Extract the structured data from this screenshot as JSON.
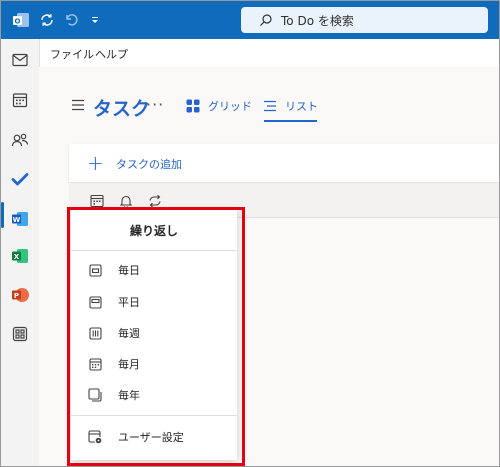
{
  "search": {
    "placeholder": "To Do を検索"
  },
  "menubar": {
    "file": "ファイル",
    "help": "ヘルプ"
  },
  "header": {
    "title": "タスク",
    "more": "···",
    "tab_grid": "グリッド",
    "tab_list": "リスト"
  },
  "add_task": {
    "plus": "+",
    "label": "タスクの追加"
  },
  "repeat_menu": {
    "title": "繰り返し",
    "items": [
      {
        "label": "毎日",
        "icon": "calendar-day-icon"
      },
      {
        "label": "平日",
        "icon": "calendar-workweek-icon"
      },
      {
        "label": "毎週",
        "icon": "calendar-week-icon"
      },
      {
        "label": "毎月",
        "icon": "calendar-month-icon"
      },
      {
        "label": "毎年",
        "icon": "calendar-year-icon"
      }
    ],
    "custom": {
      "label": "ユーザー設定",
      "icon": "calendar-settings-icon"
    }
  },
  "colors": {
    "titlebar": "#0f6cbd",
    "accent": "#2564cf",
    "highlight_frame": "#e60012"
  }
}
